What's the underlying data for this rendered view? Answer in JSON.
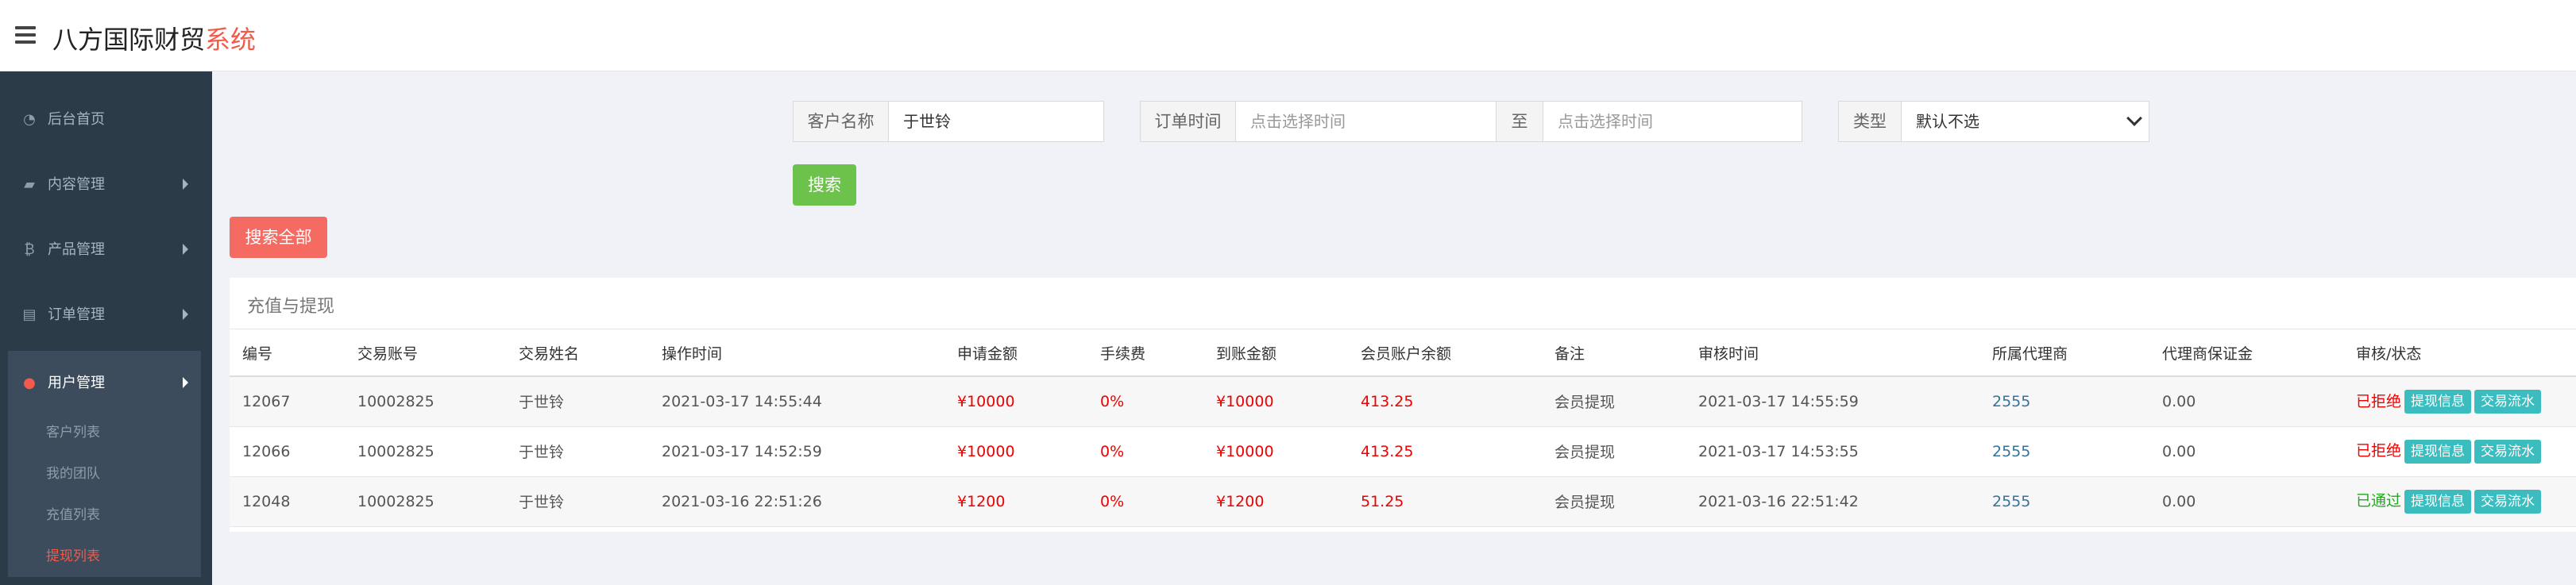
{
  "header": {
    "brand_main": "八方国际财贸",
    "brand_accent": "系统"
  },
  "sidebar": {
    "items": [
      {
        "label": "后台首页",
        "icon": "dashboard-icon"
      },
      {
        "label": "内容管理",
        "icon": "book-icon"
      },
      {
        "label": "产品管理",
        "icon": "bitcoin-icon"
      },
      {
        "label": "订单管理",
        "icon": "document-icon"
      },
      {
        "label": "用户管理",
        "icon": "user-icon"
      }
    ],
    "subitems": [
      "客户列表",
      "我的团队",
      "充值列表",
      "提现列表"
    ]
  },
  "filters": {
    "customer_label": "客户名称",
    "customer_value": "于世铃",
    "order_time_label": "订单时间",
    "time_placeholder_start": "点击选择时间",
    "to_label": "至",
    "time_placeholder_end": "点击选择时间",
    "type_label": "类型",
    "type_value": "默认不选",
    "search_button": "搜索",
    "search_all_button": "搜索全部"
  },
  "panel": {
    "title": "充值与提现",
    "columns": [
      "编号",
      "交易账号",
      "交易姓名",
      "操作时间",
      "申请金额",
      "手续费",
      "到账金额",
      "会员账户余额",
      "备注",
      "审核时间",
      "所属代理商",
      "代理商保证金",
      "审核/状态"
    ],
    "rows": [
      {
        "id": "12067",
        "account": "10002825",
        "name": "于世铃",
        "op_time": "2021-03-17 14:55:44",
        "apply": "¥10000",
        "fee": "0%",
        "received": "¥10000",
        "balance": "413.25",
        "remark": "会员提现",
        "audit_time": "2021-03-17 14:55:59",
        "agent": "2555",
        "deposit": "0.00",
        "status": "已拒绝",
        "btn1": "提现信息",
        "btn2": "交易流水"
      },
      {
        "id": "12066",
        "account": "10002825",
        "name": "于世铃",
        "op_time": "2021-03-17 14:52:59",
        "apply": "¥10000",
        "fee": "0%",
        "received": "¥10000",
        "balance": "413.25",
        "remark": "会员提现",
        "audit_time": "2021-03-17 14:53:55",
        "agent": "2555",
        "deposit": "0.00",
        "status": "已拒绝",
        "btn1": "提现信息",
        "btn2": "交易流水"
      },
      {
        "id": "12048",
        "account": "10002825",
        "name": "于世铃",
        "op_time": "2021-03-16 22:51:26",
        "apply": "¥1200",
        "fee": "0%",
        "received": "¥1200",
        "balance": "51.25",
        "remark": "会员提现",
        "audit_time": "2021-03-16 22:51:42",
        "agent": "2555",
        "deposit": "0.00",
        "status": "已通过",
        "btn1": "提现信息",
        "btn2": "交易流水"
      }
    ]
  },
  "colors": {
    "accent": "#f35a4a",
    "sidebar_bg": "#2c3b48",
    "search_green": "#6cc24a",
    "tag_teal": "#3bbdbf"
  }
}
